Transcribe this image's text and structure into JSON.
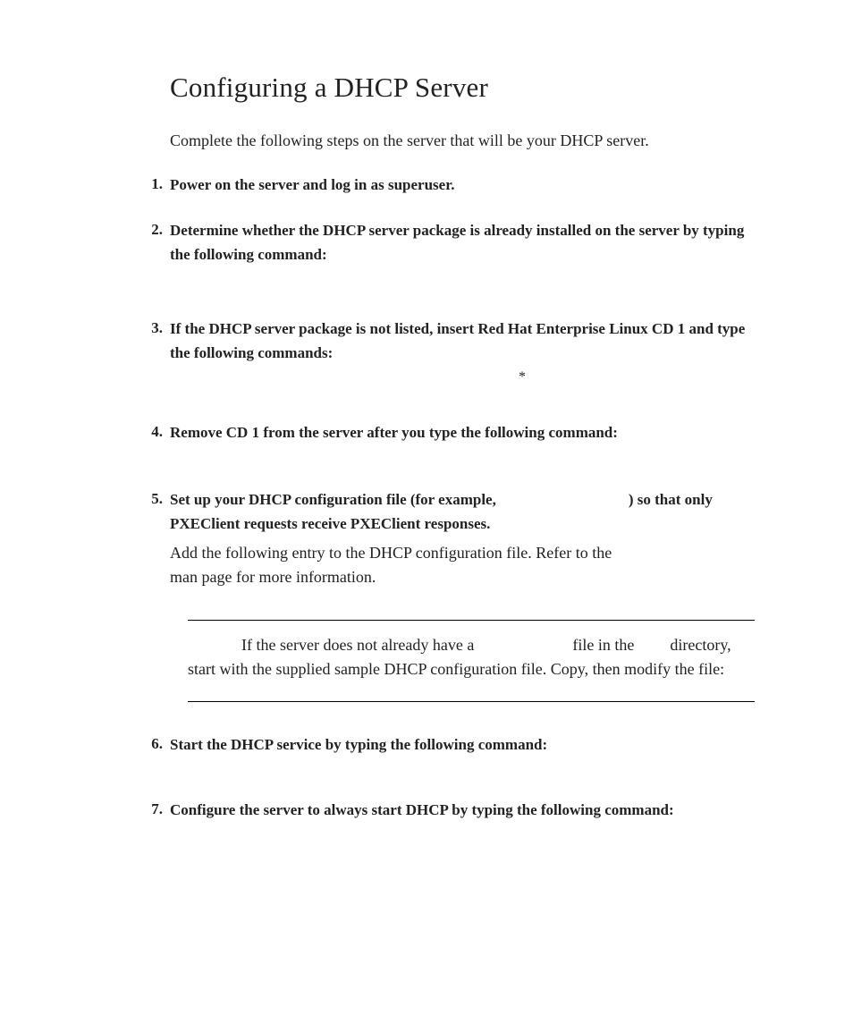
{
  "title": "Configuring a DHCP Server",
  "intro": "Complete the following steps on the server that will be your DHCP server.",
  "steps": {
    "s1": "Power on the server and log in as superuser.",
    "s2": "Determine whether the DHCP server package is already installed on the server by typing the following command:",
    "s3": "If the DHCP server package is not listed, insert Red Hat Enterprise Linux CD 1 and type the following commands:",
    "s4": "Remove CD 1 from the server after you type the following command:",
    "s5_a": "Set up your DHCP configuration file (for example,",
    "s5_b": ") so that only PXEClient requests receive PXEClient responses.",
    "s5_body_a": "Add the following entry to the DHCP configuration file. Refer to the",
    "s5_body_b": "man page for more information.",
    "s6": "Start the DHCP service by typing the following command:",
    "s7": "Configure the server to always start DHCP by typing the following command:"
  },
  "tip": {
    "a": "If the server does not already have a",
    "b": "file in the",
    "c": "directory, start with the supplied sample DHCP configuration file. Copy, then modify the file:"
  },
  "asterisk": "*"
}
